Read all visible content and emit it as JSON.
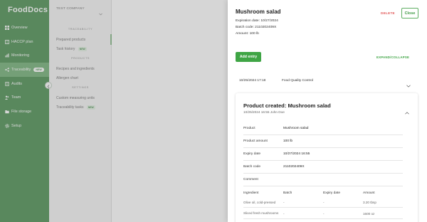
{
  "app": {
    "logo": "FoodDocs"
  },
  "sidebar": {
    "items": [
      {
        "label": "Overview",
        "icon": "grid-icon",
        "active": false
      },
      {
        "label": "HACCP plan",
        "icon": "book-icon",
        "active": false
      },
      {
        "label": "Monitoring",
        "icon": "chart-icon",
        "active": false
      },
      {
        "label": "Traceability",
        "icon": "trace-icon",
        "active": true,
        "badge": "NEW"
      },
      {
        "label": "Audits",
        "icon": "audit-icon",
        "active": false
      },
      {
        "label": "Team",
        "icon": "team-icon",
        "active": false
      },
      {
        "label": "File storage",
        "icon": "folder-icon",
        "active": false
      },
      {
        "label": "Setup",
        "icon": "gear-icon",
        "active": false
      }
    ]
  },
  "subnav": {
    "company": "TEST COMPANY",
    "section1": "TRACEABILITY",
    "item1": "Prepared products",
    "item2": "Task history",
    "item2_badge": "NEW",
    "section2": "PRODUCTS",
    "item3": "Recipes and ingredients",
    "item4": "Allergen chart",
    "section3": "SETTINGS",
    "item5": "Custom measuring units",
    "item6": "Traceability tasks",
    "item6_badge": "NEW"
  },
  "drawer": {
    "title": "Mushroom salad",
    "expiration": "Expiration date: 10/27/2024",
    "batch": "Batch code: 2110202409X",
    "amount": "Amount: 100 lb",
    "delete_label": "DELETE",
    "close_label": "Close",
    "add_entry_label": "Add entry",
    "expand_label": "EXPAND/COLLAPSE",
    "event": {
      "date": "10/25/2024 17:18",
      "name": "Food Quality Control"
    },
    "card": {
      "title": "Product created: Mushroom salad",
      "subtitle": "10/25/2024 16:55 John Doe",
      "rows": [
        {
          "k": "Product",
          "v": "Mushroom salad"
        },
        {
          "k": "Product amount",
          "v": "100 lb"
        },
        {
          "k": "Expiry date",
          "v": "10/27/2024 16:55"
        },
        {
          "k": "Batch code",
          "v": "2110202409X"
        },
        {
          "k": "Comment",
          "v": ""
        }
      ],
      "ingredients_head": [
        "Ingredient",
        "Batch",
        "Expiry date",
        "Amount"
      ],
      "ingredients": [
        {
          "ingredient": "Olive oil, cold-pressed",
          "batch": "-",
          "expiry": "-",
          "amount": "3.20 tbsp"
        },
        {
          "ingredient": "Sliced fresh mushrooms",
          "batch": "-",
          "expiry": "-",
          "amount": "1600 oz"
        }
      ]
    }
  }
}
